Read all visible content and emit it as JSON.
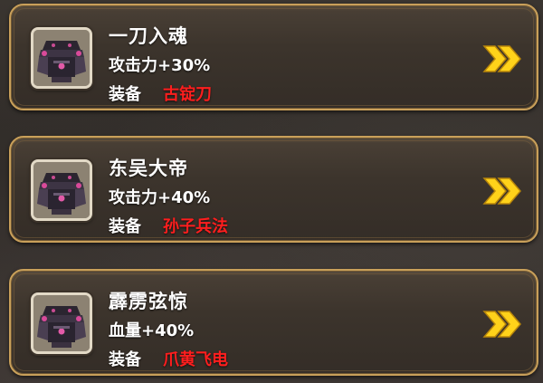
{
  "cards": [
    {
      "name": "一刀入魂",
      "effect": "攻击力+30%",
      "equip_label": "装备",
      "equip_item": "古锭刀",
      "icon": "armor-portrait-icon",
      "arrow_icon": "double-chevron-right-icon"
    },
    {
      "name": "东吴大帝",
      "effect": "攻击力+40%",
      "equip_label": "装备",
      "equip_item": "孙子兵法",
      "icon": "armor-portrait-icon",
      "arrow_icon": "double-chevron-right-icon"
    },
    {
      "name": "霹雳弦惊",
      "effect": "血量+40%",
      "equip_label": "装备",
      "equip_item": "爪黄飞电",
      "icon": "armor-portrait-icon",
      "arrow_icon": "double-chevron-right-icon"
    }
  ],
  "colors": {
    "frame_gold": "#c9a05a",
    "equip_item_red": "#ff1e1e",
    "arrow_yellow": "#ffd21a",
    "text_white": "#ffffff"
  }
}
